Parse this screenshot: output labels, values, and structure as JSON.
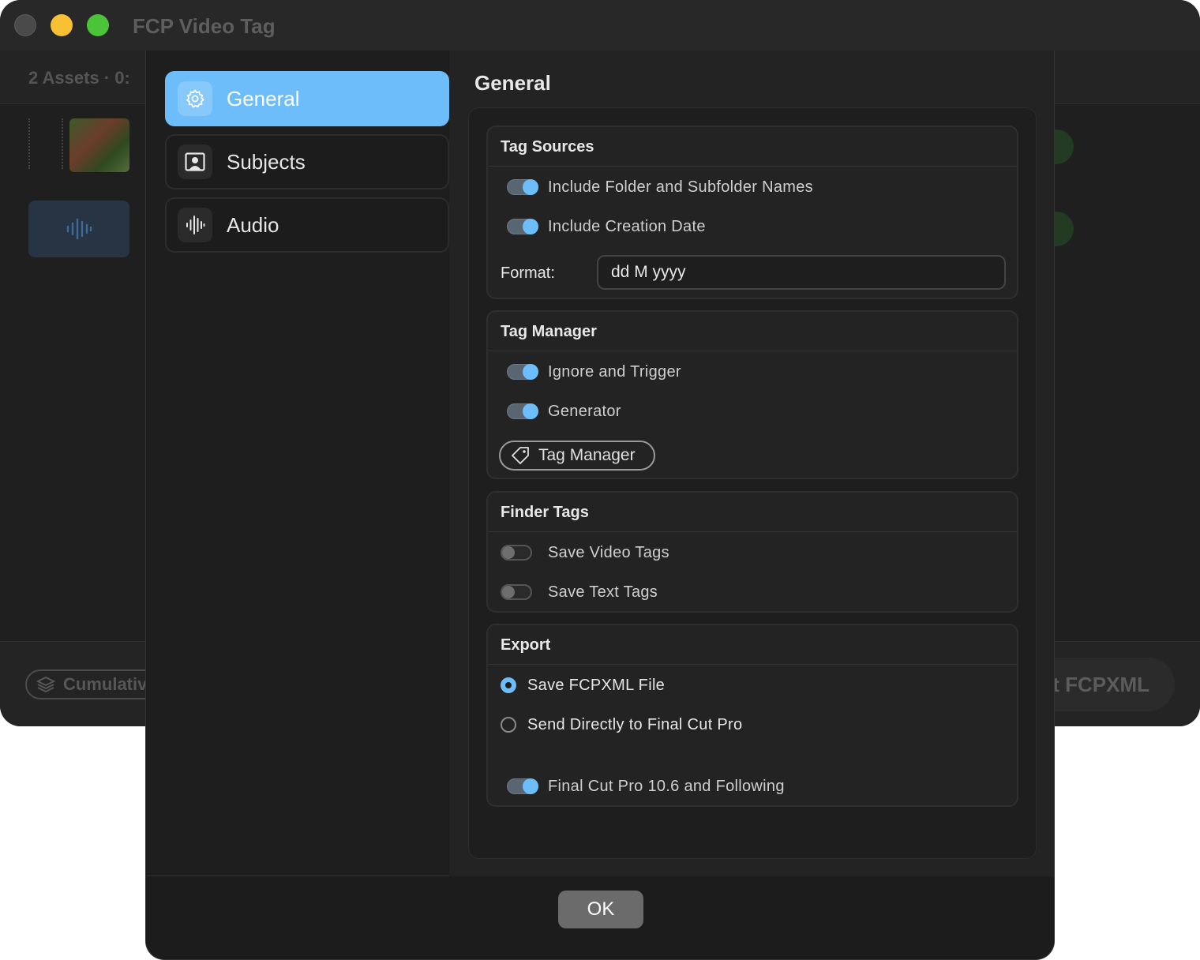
{
  "app": {
    "title": "FCP Video Tag",
    "assets_label": "2 Assets  ·  0:",
    "cumulative_label": "Cumulativ",
    "export_label": "t FCPXML"
  },
  "sidebar": {
    "items": [
      {
        "label": "General",
        "icon": "gear-icon",
        "active": true
      },
      {
        "label": "Subjects",
        "icon": "person-icon",
        "active": false
      },
      {
        "label": "Audio",
        "icon": "waveform-icon",
        "active": false
      }
    ]
  },
  "content": {
    "title": "General",
    "tag_sources": {
      "heading": "Tag Sources",
      "include_folder": {
        "label": "Include Folder and Subfolder Names",
        "on": true
      },
      "include_date": {
        "label": "Include Creation Date",
        "on": true
      },
      "format_label": "Format:",
      "format_value": "dd M yyyy"
    },
    "tag_manager": {
      "heading": "Tag Manager",
      "ignore_trigger": {
        "label": "Ignore and Trigger",
        "on": true
      },
      "generator": {
        "label": "Generator",
        "on": true
      },
      "button_label": "Tag Manager"
    },
    "finder_tags": {
      "heading": "Finder Tags",
      "save_video": {
        "label": "Save Video Tags",
        "on": false
      },
      "save_text": {
        "label": "Save Text Tags",
        "on": false
      }
    },
    "export": {
      "heading": "Export",
      "save_file": {
        "label": "Save FCPXML File",
        "selected": true
      },
      "send_direct": {
        "label": "Send Directly to Final Cut Pro",
        "selected": false
      },
      "fcp_version": {
        "label": "Final Cut Pro 10.6 and Following",
        "on": true
      }
    }
  },
  "footer": {
    "ok_label": "OK"
  },
  "colors": {
    "accent": "#6cbdf9",
    "background": "#1e1e1e"
  }
}
